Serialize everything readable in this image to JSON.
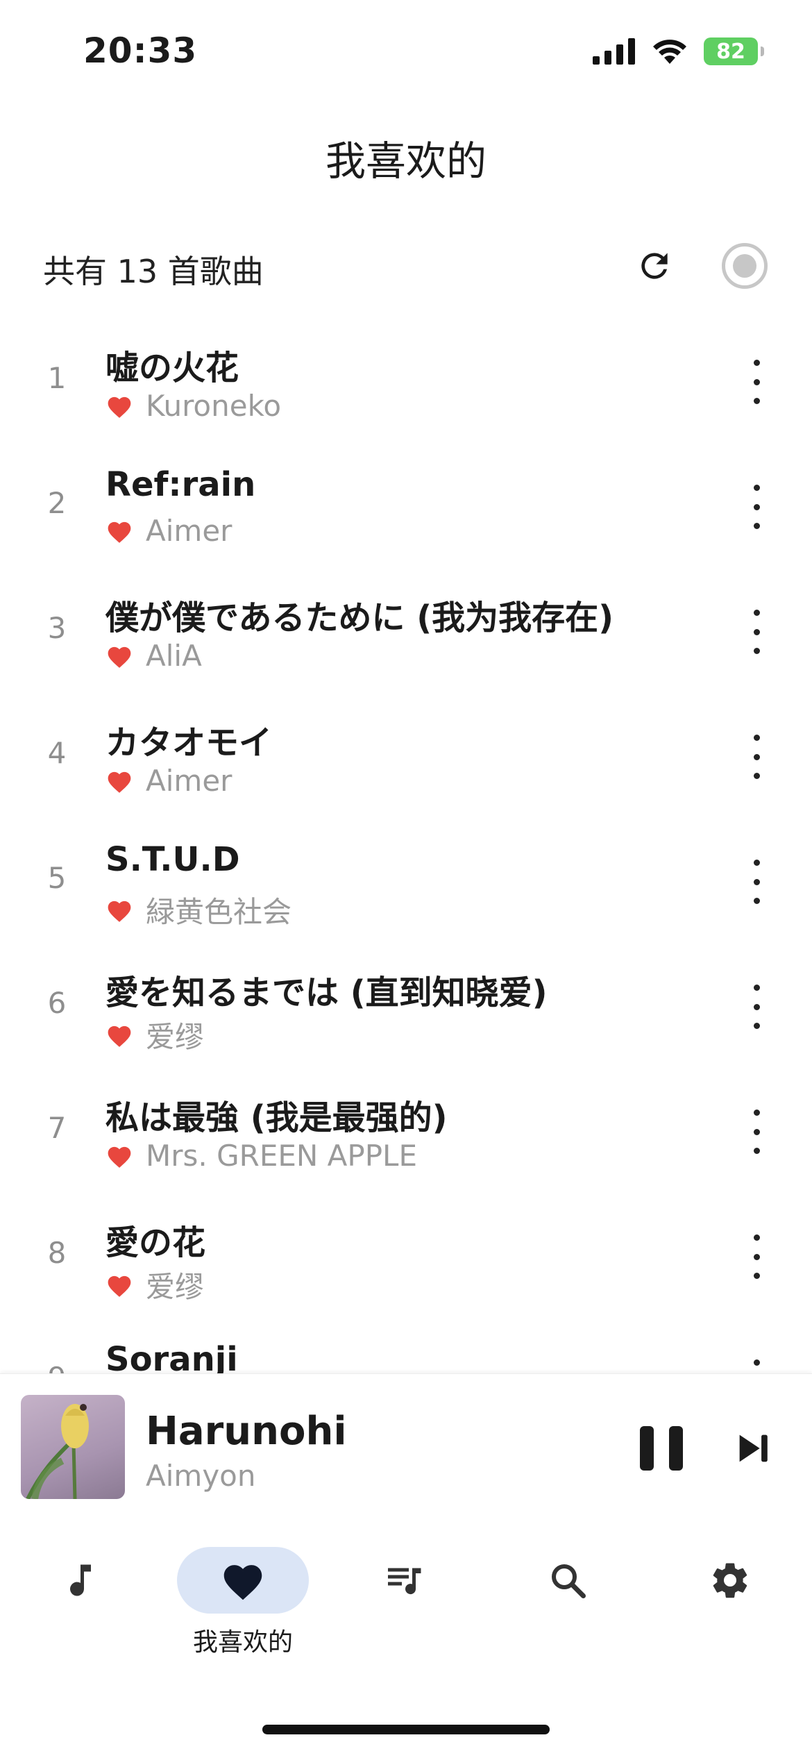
{
  "status_bar": {
    "time": "20:33",
    "battery": "82"
  },
  "header": {
    "title": "我喜欢的",
    "count_label": "共有 13 首歌曲"
  },
  "songs": [
    {
      "index": "1",
      "title": "嘘の火花",
      "artist": "Kuroneko"
    },
    {
      "index": "2",
      "title": "Ref:rain",
      "artist": "Aimer"
    },
    {
      "index": "3",
      "title": "僕が僕であるために (我为我存在)",
      "artist": "AliA"
    },
    {
      "index": "4",
      "title": "カタオモイ",
      "artist": "Aimer"
    },
    {
      "index": "5",
      "title": "S.T.U.D",
      "artist": "緑黄色社会"
    },
    {
      "index": "6",
      "title": "愛を知るまでは (直到知晓爱)",
      "artist": "爱缪"
    },
    {
      "index": "7",
      "title": "私は最強 (我是最强的)",
      "artist": "Mrs. GREEN APPLE"
    },
    {
      "index": "8",
      "title": "愛の花",
      "artist": "爱缪"
    },
    {
      "index": "9",
      "title": "Soranji",
      "artist": ""
    }
  ],
  "now_playing": {
    "title": "Harunohi",
    "artist": "Aimyon"
  },
  "nav": {
    "favorites_label": "我喜欢的"
  },
  "colors": {
    "heart": "#e8473e",
    "nav_active_bg": "#dbe5f6",
    "battery": "#5fcf62"
  }
}
